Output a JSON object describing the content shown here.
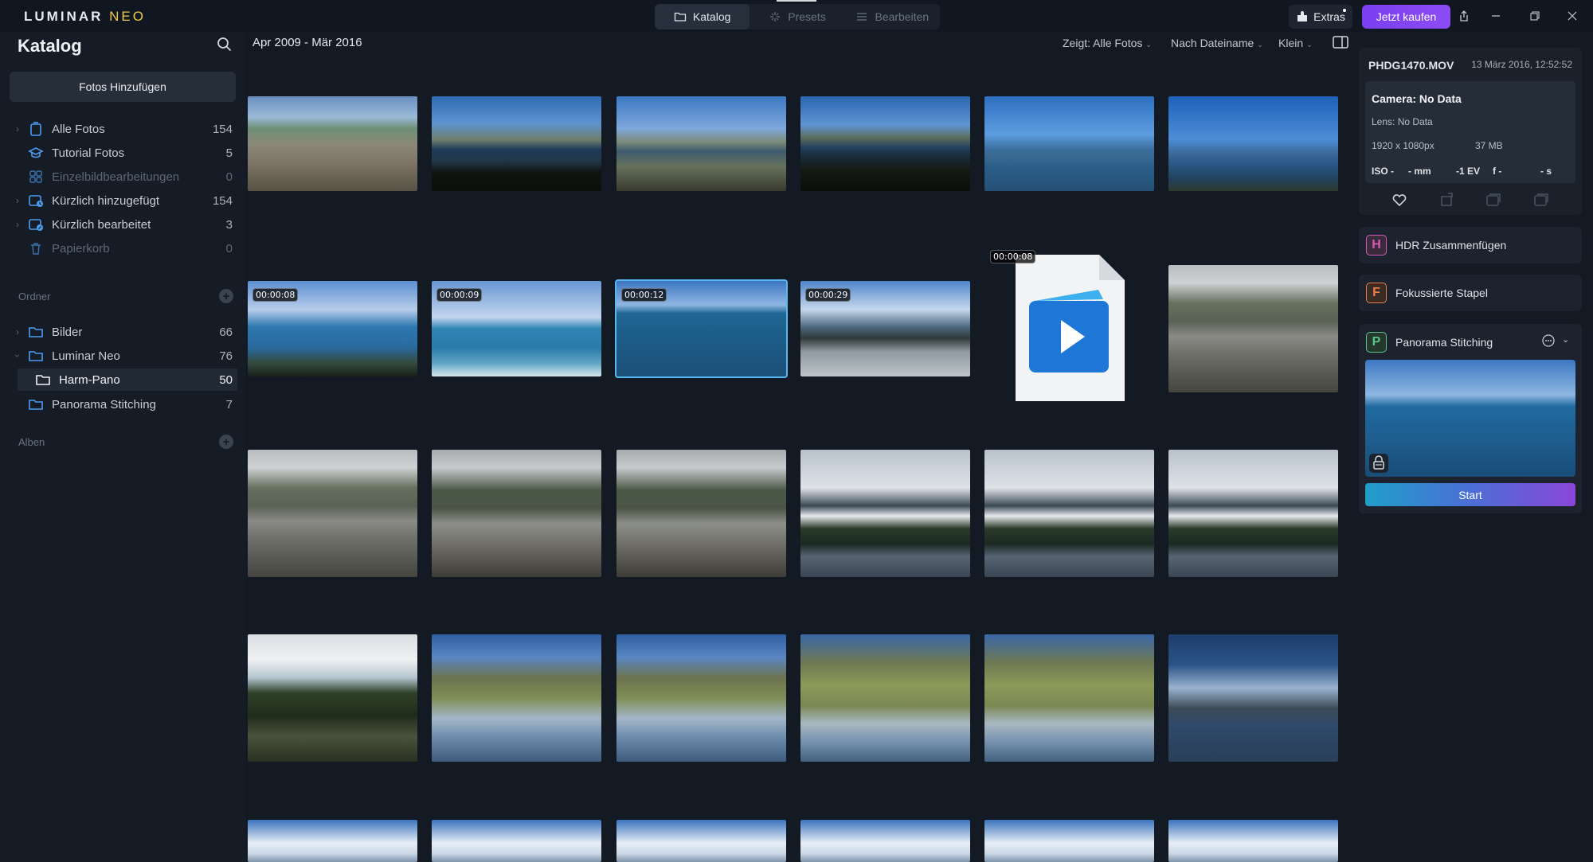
{
  "app": {
    "logo_main": "LUMINAR",
    "logo_sub": "NEO",
    "tabs": [
      {
        "label": "Katalog",
        "icon": "folder-icon",
        "active": true
      },
      {
        "label": "Presets",
        "icon": "sparkle-icon",
        "active": false
      },
      {
        "label": "Bearbeiten",
        "icon": "sliders-icon",
        "active": false
      }
    ],
    "extras_label": "Extras",
    "buy_label": "Jetzt kaufen",
    "accent_color": "#8c4cf5"
  },
  "sidebar": {
    "title": "Katalog",
    "add_photos": "Fotos Hinzufügen",
    "items": [
      {
        "label": "Alle Fotos",
        "count": "154",
        "icon": "all-photos-icon",
        "dim": false
      },
      {
        "label": "Tutorial Fotos",
        "count": "5",
        "icon": "graduation-cap-icon",
        "dim": false
      },
      {
        "label": "Einzelbildbearbeitungen",
        "count": "0",
        "icon": "grid-icon",
        "dim": true
      },
      {
        "label": "Kürzlich hinzugefügt",
        "count": "154",
        "icon": "recently-added-icon",
        "dim": false
      },
      {
        "label": "Kürzlich bearbeitet",
        "count": "3",
        "icon": "recently-edited-icon",
        "dim": false
      },
      {
        "label": "Papierkorb",
        "count": "0",
        "icon": "trash-icon",
        "dim": true
      }
    ],
    "folders_heading": "Ordner",
    "folders": [
      {
        "label": "Bilder",
        "count": "66"
      },
      {
        "label": "Luminar Neo",
        "count": "76"
      },
      {
        "label": "Harm-Pano",
        "count": "50"
      },
      {
        "label": "Panorama Stitching",
        "count": "7"
      }
    ],
    "albums_heading": "Alben"
  },
  "main": {
    "date_range": "Apr 2009 - Mär 2016",
    "filters": {
      "show": "Zeigt: Alle Fotos",
      "sort": "Nach Dateiname",
      "size": "Klein"
    },
    "durations": [
      "00:00:08",
      "00:00:09",
      "00:00:12",
      "00:00:29",
      "00:00:08"
    ]
  },
  "info": {
    "filename": "PHDG1470.MOV",
    "datetime": "13 März 2016, 12:52:52",
    "camera": "Camera: No Data",
    "lens": "Lens: No Data",
    "resolution": "1920 x 1080px",
    "filesize": "37 MB",
    "iso": "ISO -",
    "focal": "- mm",
    "ev": "-1 EV",
    "aperture": "f -",
    "shutter": "- s"
  },
  "tools": [
    {
      "letter": "H",
      "label": "HDR Zusammenfügen",
      "color": "#d25ab6"
    },
    {
      "letter": "F",
      "label": "Fokussierte Stapel",
      "color": "#e8804a"
    },
    {
      "letter": "P",
      "label": "Panorama Stitching",
      "color": "#5ec08a"
    }
  ],
  "start_label": "Start"
}
